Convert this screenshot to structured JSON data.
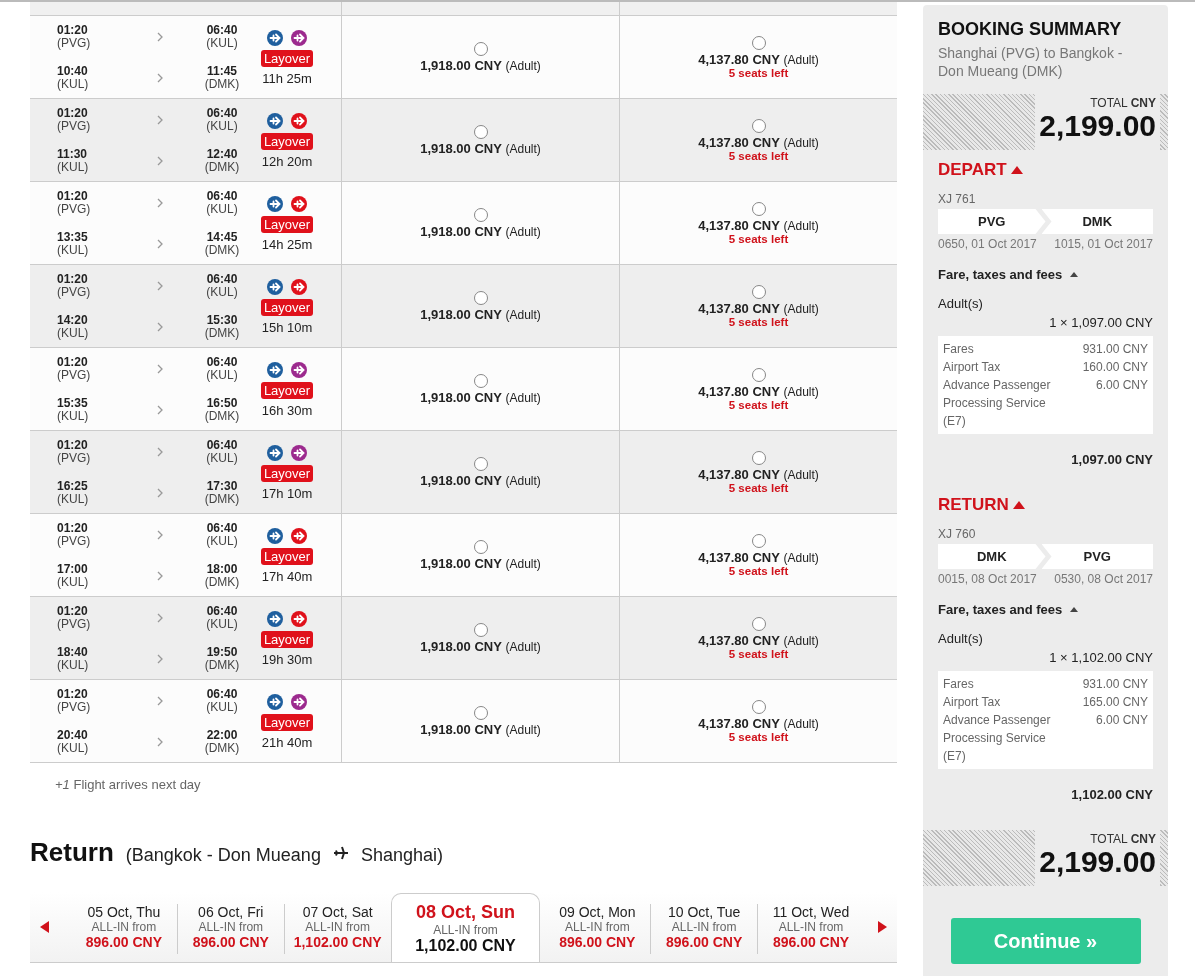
{
  "flights": [
    {
      "legs": [
        {
          "dep_time": "01:20",
          "dep_code": "(PVG)",
          "arr_time": "06:40",
          "arr_code": "(KUL)"
        },
        {
          "dep_time": "10:40",
          "dep_code": "(KUL)",
          "arr_time": "11:45",
          "arr_code": "(DMK)"
        }
      ],
      "airlines": [
        {
          "color": "#1f5f9e"
        },
        {
          "color": "#9c2a8e"
        }
      ],
      "badge": "Layover",
      "duration": "11h 25m",
      "fares": [
        {
          "price": "1,918.00 CNY",
          "pax": "(Adult)",
          "selected": false
        },
        {
          "price": "4,137.80 CNY",
          "pax": "(Adult)",
          "seats": "5 seats left",
          "selected": false
        }
      ]
    },
    {
      "legs": [
        {
          "dep_time": "01:20",
          "dep_code": "(PVG)",
          "arr_time": "06:40",
          "arr_code": "(KUL)"
        },
        {
          "dep_time": "11:30",
          "dep_code": "(KUL)",
          "arr_time": "12:40",
          "arr_code": "(DMK)"
        }
      ],
      "airlines": [
        {
          "color": "#1f5f9e"
        },
        {
          "color": "#e0111b"
        }
      ],
      "badge": "Layover",
      "duration": "12h 20m",
      "fares": [
        {
          "price": "1,918.00 CNY",
          "pax": "(Adult)",
          "selected": false
        },
        {
          "price": "4,137.80 CNY",
          "pax": "(Adult)",
          "seats": "5 seats left",
          "selected": false
        }
      ]
    },
    {
      "legs": [
        {
          "dep_time": "01:20",
          "dep_code": "(PVG)",
          "arr_time": "06:40",
          "arr_code": "(KUL)"
        },
        {
          "dep_time": "13:35",
          "dep_code": "(KUL)",
          "arr_time": "14:45",
          "arr_code": "(DMK)"
        }
      ],
      "airlines": [
        {
          "color": "#1f5f9e"
        },
        {
          "color": "#e0111b"
        }
      ],
      "badge": "Layover",
      "duration": "14h 25m",
      "fares": [
        {
          "price": "1,918.00 CNY",
          "pax": "(Adult)",
          "selected": false
        },
        {
          "price": "4,137.80 CNY",
          "pax": "(Adult)",
          "seats": "5 seats left",
          "selected": false
        }
      ]
    },
    {
      "legs": [
        {
          "dep_time": "01:20",
          "dep_code": "(PVG)",
          "arr_time": "06:40",
          "arr_code": "(KUL)"
        },
        {
          "dep_time": "14:20",
          "dep_code": "(KUL)",
          "arr_time": "15:30",
          "arr_code": "(DMK)"
        }
      ],
      "airlines": [
        {
          "color": "#1f5f9e"
        },
        {
          "color": "#e0111b"
        }
      ],
      "badge": "Layover",
      "duration": "15h 10m",
      "fares": [
        {
          "price": "1,918.00 CNY",
          "pax": "(Adult)",
          "selected": false
        },
        {
          "price": "4,137.80 CNY",
          "pax": "(Adult)",
          "seats": "5 seats left",
          "selected": false
        }
      ]
    },
    {
      "legs": [
        {
          "dep_time": "01:20",
          "dep_code": "(PVG)",
          "arr_time": "06:40",
          "arr_code": "(KUL)"
        },
        {
          "dep_time": "15:35",
          "dep_code": "(KUL)",
          "arr_time": "16:50",
          "arr_code": "(DMK)"
        }
      ],
      "airlines": [
        {
          "color": "#1f5f9e"
        },
        {
          "color": "#9c2a8e"
        }
      ],
      "badge": "Layover",
      "duration": "16h 30m",
      "fares": [
        {
          "price": "1,918.00 CNY",
          "pax": "(Adult)",
          "selected": false
        },
        {
          "price": "4,137.80 CNY",
          "pax": "(Adult)",
          "seats": "5 seats left",
          "selected": false
        }
      ]
    },
    {
      "legs": [
        {
          "dep_time": "01:20",
          "dep_code": "(PVG)",
          "arr_time": "06:40",
          "arr_code": "(KUL)"
        },
        {
          "dep_time": "16:25",
          "dep_code": "(KUL)",
          "arr_time": "17:30",
          "arr_code": "(DMK)"
        }
      ],
      "airlines": [
        {
          "color": "#1f5f9e"
        },
        {
          "color": "#9c2a8e"
        }
      ],
      "badge": "Layover",
      "duration": "17h 10m",
      "fares": [
        {
          "price": "1,918.00 CNY",
          "pax": "(Adult)",
          "selected": false
        },
        {
          "price": "4,137.80 CNY",
          "pax": "(Adult)",
          "seats": "5 seats left",
          "selected": false
        }
      ]
    },
    {
      "legs": [
        {
          "dep_time": "01:20",
          "dep_code": "(PVG)",
          "arr_time": "06:40",
          "arr_code": "(KUL)"
        },
        {
          "dep_time": "17:00",
          "dep_code": "(KUL)",
          "arr_time": "18:00",
          "arr_code": "(DMK)"
        }
      ],
      "airlines": [
        {
          "color": "#1f5f9e"
        },
        {
          "color": "#e0111b"
        }
      ],
      "badge": "Layover",
      "duration": "17h 40m",
      "fares": [
        {
          "price": "1,918.00 CNY",
          "pax": "(Adult)",
          "selected": false
        },
        {
          "price": "4,137.80 CNY",
          "pax": "(Adult)",
          "seats": "5 seats left",
          "selected": false
        }
      ]
    },
    {
      "legs": [
        {
          "dep_time": "01:20",
          "dep_code": "(PVG)",
          "arr_time": "06:40",
          "arr_code": "(KUL)"
        },
        {
          "dep_time": "18:40",
          "dep_code": "(KUL)",
          "arr_time": "19:50",
          "arr_code": "(DMK)"
        }
      ],
      "airlines": [
        {
          "color": "#1f5f9e"
        },
        {
          "color": "#e0111b"
        }
      ],
      "badge": "Layover",
      "duration": "19h 30m",
      "fares": [
        {
          "price": "1,918.00 CNY",
          "pax": "(Adult)",
          "selected": false
        },
        {
          "price": "4,137.80 CNY",
          "pax": "(Adult)",
          "seats": "5 seats left",
          "selected": false
        }
      ]
    },
    {
      "legs": [
        {
          "dep_time": "01:20",
          "dep_code": "(PVG)",
          "arr_time": "06:40",
          "arr_code": "(KUL)"
        },
        {
          "dep_time": "20:40",
          "dep_code": "(KUL)",
          "arr_time": "22:00",
          "arr_code": "(DMK)"
        }
      ],
      "airlines": [
        {
          "color": "#1f5f9e"
        },
        {
          "color": "#9c2a8e"
        }
      ],
      "badge": "Layover",
      "duration": "21h 40m",
      "fares": [
        {
          "price": "1,918.00 CNY",
          "pax": "(Adult)",
          "selected": false
        },
        {
          "price": "4,137.80 CNY",
          "pax": "(Adult)",
          "seats": "5 seats left",
          "selected": false
        }
      ]
    }
  ],
  "footnote": "*+1* Flight arrives next day",
  "return_heading": {
    "title": "Return",
    "from": "(Bangkok - Don Mueang",
    "to": "Shanghai)"
  },
  "dates": [
    {
      "day": "05 Oct, Thu",
      "label": "ALL-IN from",
      "price": "896.00 CNY",
      "selected": false
    },
    {
      "day": "06 Oct, Fri",
      "label": "ALL-IN from",
      "price": "896.00 CNY",
      "selected": false
    },
    {
      "day": "07 Oct, Sat",
      "label": "ALL-IN from",
      "price": "1,102.00 CNY",
      "selected": false
    },
    {
      "day": "08 Oct, Sun",
      "label": "ALL-IN from",
      "price": "1,102.00 CNY",
      "selected": true
    },
    {
      "day": "09 Oct, Mon",
      "label": "ALL-IN from",
      "price": "896.00 CNY",
      "selected": false
    },
    {
      "day": "10 Oct, Tue",
      "label": "ALL-IN from",
      "price": "896.00 CNY",
      "selected": false
    },
    {
      "day": "11 Oct, Wed",
      "label": "ALL-IN from",
      "price": "896.00 CNY",
      "selected": false
    }
  ],
  "summary": {
    "title": "BOOKING SUMMARY",
    "route": "Shanghai (PVG) to Bangkok - Don Mueang (DMK)",
    "total_top": {
      "label": "TOTAL **CNY**",
      "amount": "2,199.00"
    },
    "sections": [
      {
        "heading": "DEPART",
        "expanded": true,
        "flight_no": "XJ 761",
        "from": "PVG",
        "to": "DMK",
        "from_time": "0650, 01 Oct 2017",
        "to_time": "1015, 01 Oct 2017",
        "fees_heading": "Fare, taxes and fees",
        "fees_expanded": true,
        "pax": "Adult(s)",
        "pax_total": "1 × 1,097.00 CNY",
        "items": [
          {
            "name": "Fares",
            "amount": "931.00 CNY"
          },
          {
            "name": "Airport Tax",
            "amount": "160.00 CNY"
          },
          {
            "name": "Advance Passenger Processing Service (E7)",
            "amount": "6.00 CNY"
          }
        ],
        "subtotal": "1,097.00 CNY"
      },
      {
        "heading": "RETURN",
        "expanded": true,
        "flight_no": "XJ 760",
        "from": "DMK",
        "to": "PVG",
        "from_time": "0015, 08 Oct 2017",
        "to_time": "0530, 08 Oct 2017",
        "fees_heading": "Fare, taxes and fees",
        "fees_expanded": true,
        "pax": "Adult(s)",
        "pax_total": "1 × 1,102.00 CNY",
        "items": [
          {
            "name": "Fares",
            "amount": "931.00 CNY"
          },
          {
            "name": "Airport Tax",
            "amount": "165.00 CNY"
          },
          {
            "name": "Advance Passenger Processing Service (E7)",
            "amount": "6.00 CNY"
          }
        ],
        "subtotal": "1,102.00 CNY"
      }
    ],
    "total_bottom": {
      "label": "TOTAL **CNY**",
      "amount": "2,199.00"
    },
    "continue": "Continue »"
  }
}
